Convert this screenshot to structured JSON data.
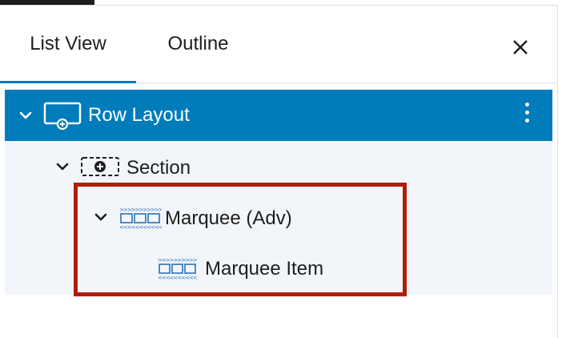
{
  "tabs": {
    "list_view": "List View",
    "outline": "Outline"
  },
  "close": {
    "glyph": "×"
  },
  "tree": {
    "items": [
      {
        "label": "Row Layout",
        "icon": "row-layout-icon",
        "selected": true
      },
      {
        "label": "Section",
        "icon": "section-icon"
      },
      {
        "label": "Marquee (Adv)",
        "icon": "marquee-icon"
      },
      {
        "label": "Marquee Item",
        "icon": "marquee-item-icon"
      }
    ]
  },
  "colors": {
    "accent": "#007cba",
    "highlight": "#b01c0a",
    "tree_bg": "#f2f6fa"
  }
}
